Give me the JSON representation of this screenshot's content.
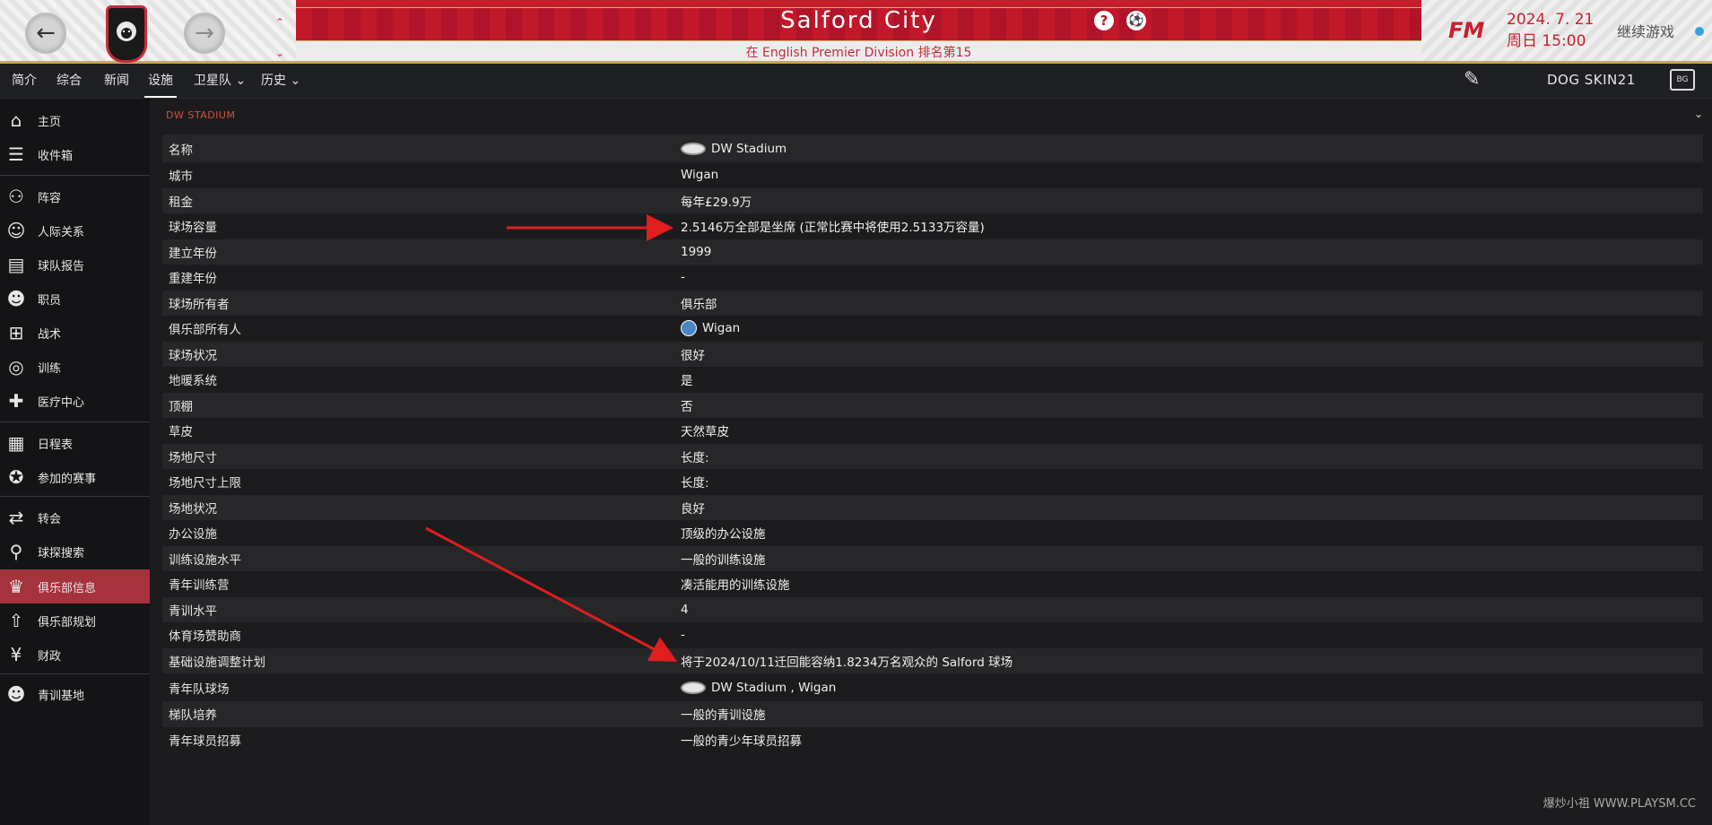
{
  "header": {
    "club_title": "Salford City",
    "subtitle": "在 English Premier Division 排名第15",
    "date": "2024. 7. 21",
    "time": "周日 15:00",
    "continue_label": "继续游戏",
    "fm_logo": "FM",
    "help_symbol": "?",
    "ball_symbol": "⚽"
  },
  "nav": {
    "items": [
      "简介",
      "综合",
      "新闻",
      "设施",
      "卫星队 ⌄",
      "历史 ⌄"
    ],
    "skin": "DOG SKIN21",
    "bg_label": "BG"
  },
  "sidebar": {
    "items": [
      {
        "label": "主页",
        "icon": "home-icon",
        "glyph": "⌂"
      },
      {
        "label": "收件箱",
        "icon": "inbox-icon",
        "glyph": "☰"
      },
      {
        "label": "阵容",
        "icon": "squad-icon",
        "glyph": "⚇"
      },
      {
        "label": "人际关系",
        "icon": "relations-icon",
        "glyph": "☺"
      },
      {
        "label": "球队报告",
        "icon": "report-icon",
        "glyph": "▤"
      },
      {
        "label": "职员",
        "icon": "staff-icon",
        "glyph": "☻"
      },
      {
        "label": "战术",
        "icon": "tactics-icon",
        "glyph": "⊞"
      },
      {
        "label": "训练",
        "icon": "training-icon",
        "glyph": "◎"
      },
      {
        "label": "医疗中心",
        "icon": "medical-icon",
        "glyph": "✚"
      },
      {
        "label": "日程表",
        "icon": "calendar-icon",
        "glyph": "▦"
      },
      {
        "label": "参加的赛事",
        "icon": "competitions-icon",
        "glyph": "✪"
      },
      {
        "label": "转会",
        "icon": "transfers-icon",
        "glyph": "⇄"
      },
      {
        "label": "球探搜索",
        "icon": "scouting-icon",
        "glyph": "⚲"
      },
      {
        "label": "俱乐部信息",
        "icon": "trophy-icon",
        "glyph": "♛"
      },
      {
        "label": "俱乐部规划",
        "icon": "rocket-icon",
        "glyph": "⇧"
      },
      {
        "label": "财政",
        "icon": "finance-icon",
        "glyph": "¥"
      },
      {
        "label": "青训基地",
        "icon": "youth-icon",
        "glyph": "☻"
      }
    ],
    "active_index": 13
  },
  "content": {
    "section_title": "DW STADIUM",
    "rows": [
      {
        "label": "名称",
        "value": "DW Stadium",
        "icon": "stadium-icon"
      },
      {
        "label": "城市",
        "value": "Wigan"
      },
      {
        "label": "租金",
        "value": "每年£29.9万"
      },
      {
        "label": "球场容量",
        "value": "2.5146万全部是坐席 (正常比赛中将使用2.5133万容量)"
      },
      {
        "label": "建立年份",
        "value": "1999"
      },
      {
        "label": "重建年份",
        "value": "-"
      },
      {
        "label": "球场所有者",
        "value": "俱乐部"
      },
      {
        "label": "俱乐部所有人",
        "value": "Wigan",
        "icon": "wigan-crest-icon"
      },
      {
        "label": "球场状况",
        "value": "很好"
      },
      {
        "label": "地暖系统",
        "value": "是"
      },
      {
        "label": "顶棚",
        "value": "否"
      },
      {
        "label": "草皮",
        "value": "天然草皮"
      },
      {
        "label": "场地尺寸",
        "value": "长度:"
      },
      {
        "label": "场地尺寸上限",
        "value": "长度:"
      },
      {
        "label": "场地状况",
        "value": "良好"
      },
      {
        "label": "办公设施",
        "value": "顶级的办公设施"
      },
      {
        "label": "训练设施水平",
        "value": "一般的训练设施"
      },
      {
        "label": "青年训练营",
        "value": "凑活能用的训练设施"
      },
      {
        "label": "青训水平",
        "value": "4"
      },
      {
        "label": "体育场赞助商",
        "value": "-"
      },
      {
        "label": "基础设施调整计划",
        "value": "将于2024/10/11迁回能容纳1.8234万名观众的 Salford 球场"
      },
      {
        "label": "青年队球场",
        "value": "DW Stadium , Wigan",
        "icon": "stadium-icon"
      },
      {
        "label": "梯队培养",
        "value": "一般的青训设施"
      },
      {
        "label": "青年球员招募",
        "value": "一般的青少年球员招募"
      }
    ]
  },
  "watermark": "爆炒小祖 WWW.PLAYSM.CC",
  "colors": {
    "accent_red": "#c8202f",
    "active_sidebar": "#a5323c",
    "gold": "#c9a45c"
  }
}
